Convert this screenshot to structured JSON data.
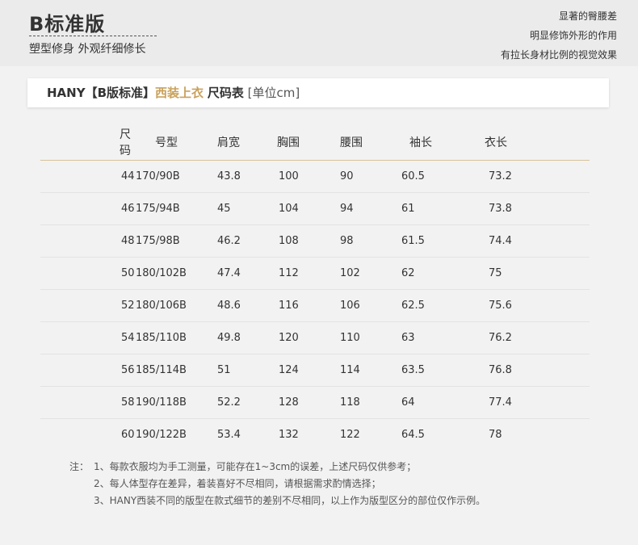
{
  "header": {
    "title": "B标准版",
    "subtitle": "塑型修身 外观纤细修长",
    "features": [
      "显著的臀腰差",
      "明显修饰外形的作用",
      "有拉长身材比例的视觉效果"
    ]
  },
  "card": {
    "brand": "HANY【B版标准】",
    "product": "西装上衣",
    "chart_label": "尺码表",
    "unit": "[单位cm]"
  },
  "table": {
    "headers": [
      "尺码",
      "号型",
      "肩宽",
      "胸围",
      "腰围",
      "袖长",
      "衣长"
    ],
    "rows": [
      [
        "44",
        "170/90B",
        "43.8",
        "100",
        "90",
        "60.5",
        "73.2"
      ],
      [
        "46",
        "175/94B",
        "45",
        "104",
        "94",
        "61",
        "73.8"
      ],
      [
        "48",
        "175/98B",
        "46.2",
        "108",
        "98",
        "61.5",
        "74.4"
      ],
      [
        "50",
        "180/102B",
        "47.4",
        "112",
        "102",
        "62",
        "75"
      ],
      [
        "52",
        "180/106B",
        "48.6",
        "116",
        "106",
        "62.5",
        "75.6"
      ],
      [
        "54",
        "185/110B",
        "49.8",
        "120",
        "110",
        "63",
        "76.2"
      ],
      [
        "56",
        "185/114B",
        "51",
        "124",
        "114",
        "63.5",
        "76.8"
      ],
      [
        "58",
        "190/118B",
        "52.2",
        "128",
        "118",
        "64",
        "77.4"
      ],
      [
        "60",
        "190/122B",
        "53.4",
        "132",
        "122",
        "64.5",
        "78"
      ]
    ]
  },
  "notes": {
    "prefix": "注：",
    "items": [
      "1、每款衣服均为手工测量，可能存在1~3cm的误差，上述尺码仅供参考；",
      "2、每人体型存在差异，着装喜好不尽相同，请根据需求酌情选择；",
      "3、HANY西装不同的版型在款式细节的差别不尽相同，以上作为版型区分的部位仅作示例。"
    ]
  },
  "colors": {
    "accent": "#c9a15b",
    "background": "#f2f2f2",
    "header_band": "#ebebeb"
  }
}
